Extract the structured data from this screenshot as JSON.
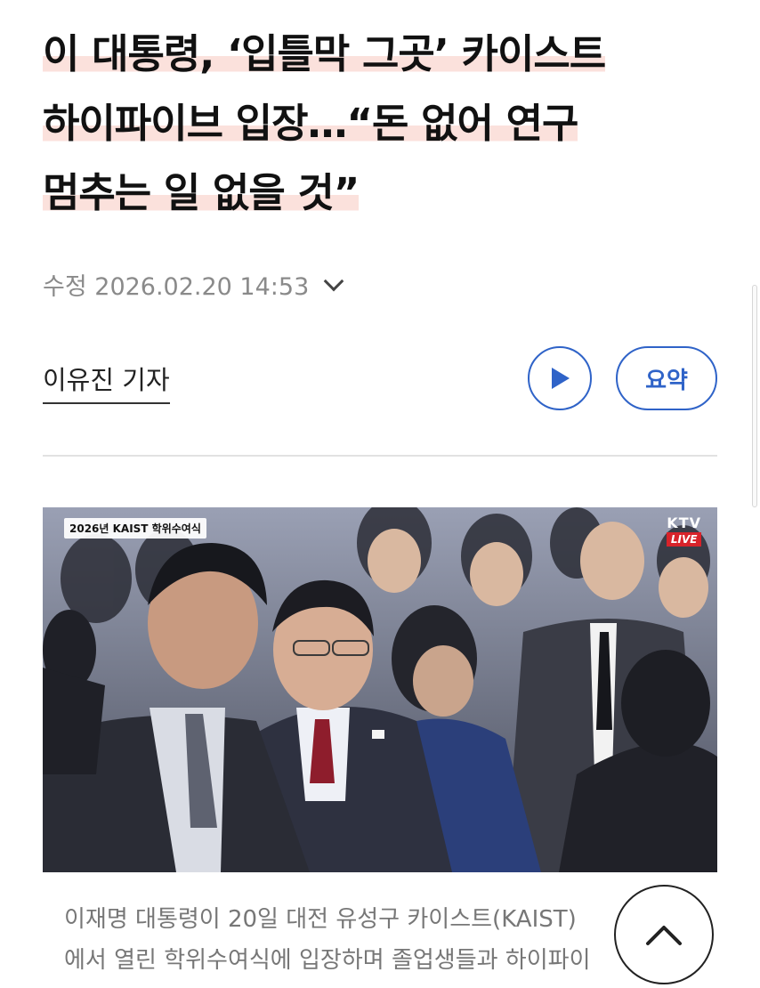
{
  "article": {
    "headline_lines": [
      "이 대통령, ‘입틀막 그곳’ 카이스트",
      "하이파이브 입장…“돈 없어 연구",
      "멈추는 일 없을 것”"
    ],
    "modified": "수정 2026.02.20 14:53",
    "reporter": "이유진 기자",
    "summary_label": "요약"
  },
  "photo": {
    "overlay_tag": "2026년 KAIST 학위수여식",
    "broadcaster": "KTV",
    "live_badge": "LIVE"
  },
  "caption": {
    "lines": [
      "이재명 대통령이 20일 대전 유성구 카이스트(KAIST)",
      "에서 열린 학위수여식에 입장하며 졸업생들과 하이파이"
    ]
  },
  "icons": {
    "expand": "chevron-down-icon",
    "audio": "play-icon",
    "scroll_top": "chevron-up-icon"
  },
  "colors": {
    "accent": "#2f63c8",
    "highlight": "#fbe1dc",
    "live_red": "#d8232a"
  }
}
